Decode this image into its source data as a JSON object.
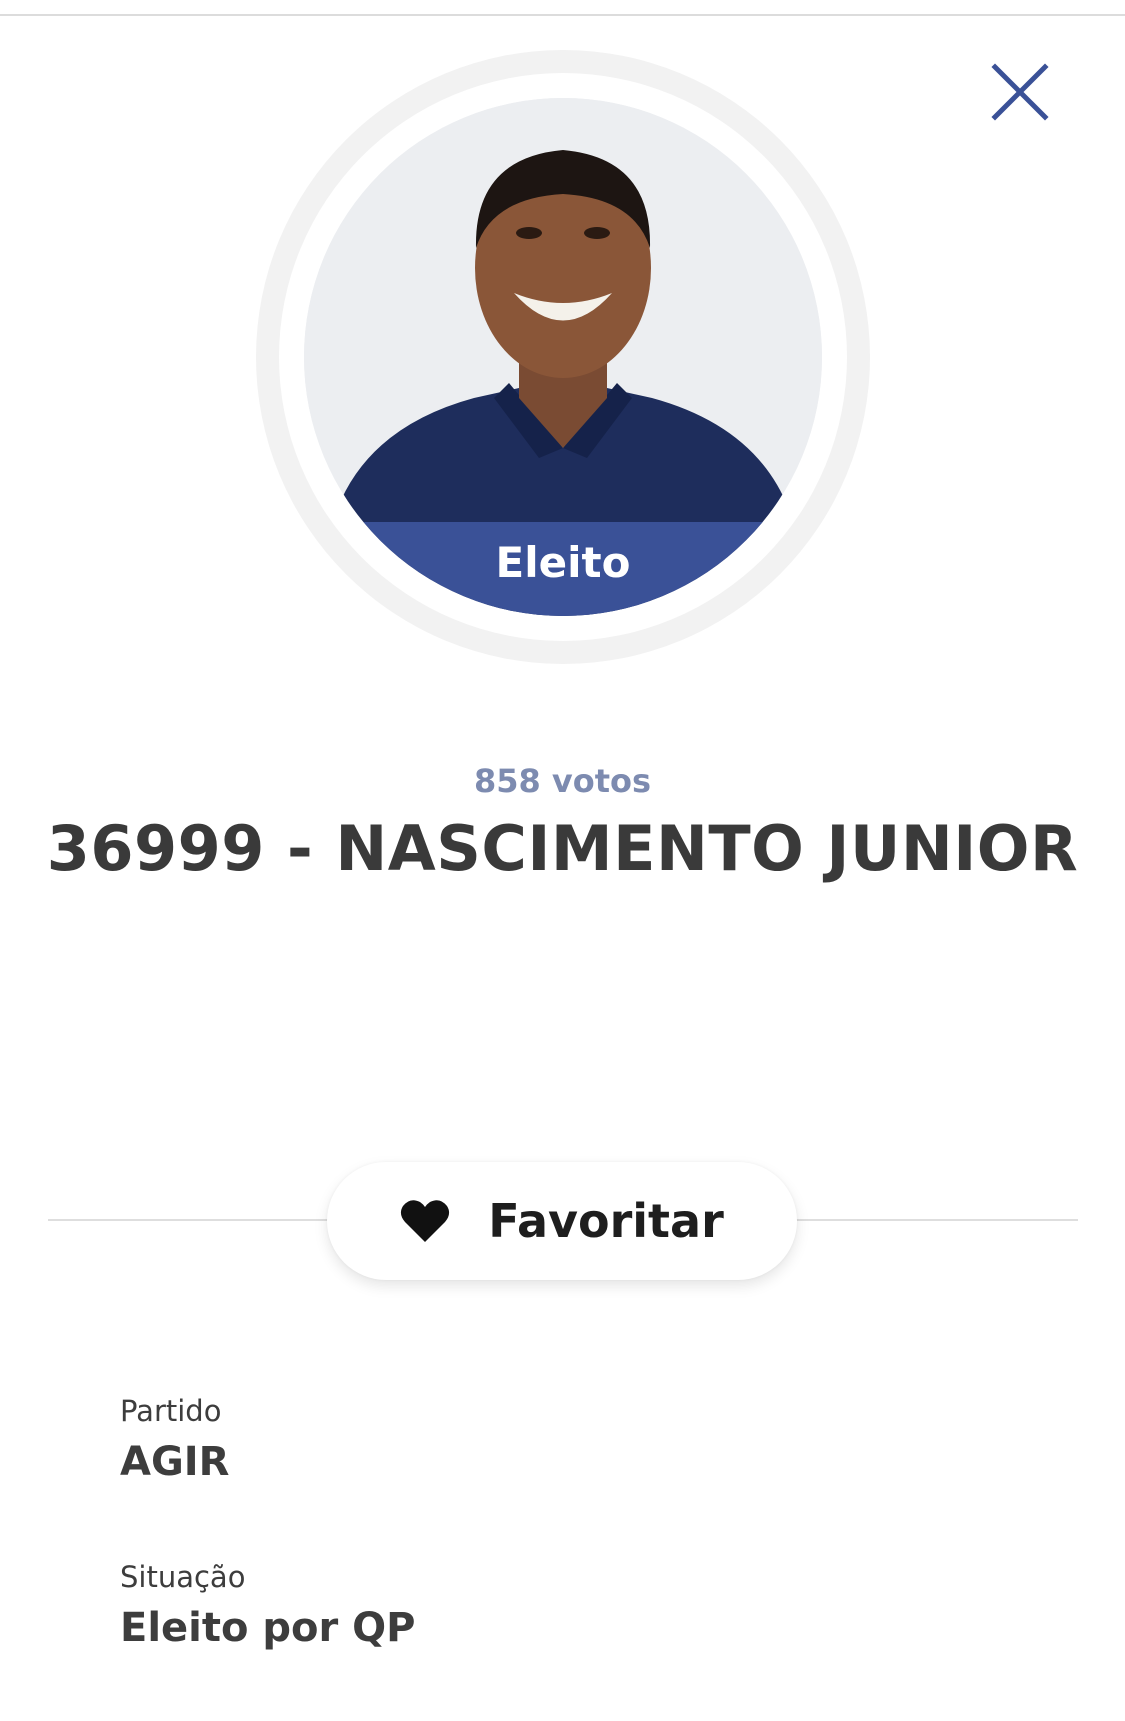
{
  "header": {
    "close_icon": "close-icon"
  },
  "candidate": {
    "photo": "candidate-photo",
    "status_badge": "Eleito",
    "votes": "858 votos",
    "title": "36999 - NASCIMENTO JUNIOR"
  },
  "actions": {
    "favorite_label": "Favoritar",
    "favorite_icon": "heart-icon"
  },
  "details": {
    "party_label": "Partido",
    "party_value": "AGIR",
    "situation_label": "Situação",
    "situation_value": "Eleito por QP"
  },
  "colors": {
    "accent": "#3a5197",
    "votes_text": "#7d8bb0",
    "body_text": "#3d3d3d"
  }
}
